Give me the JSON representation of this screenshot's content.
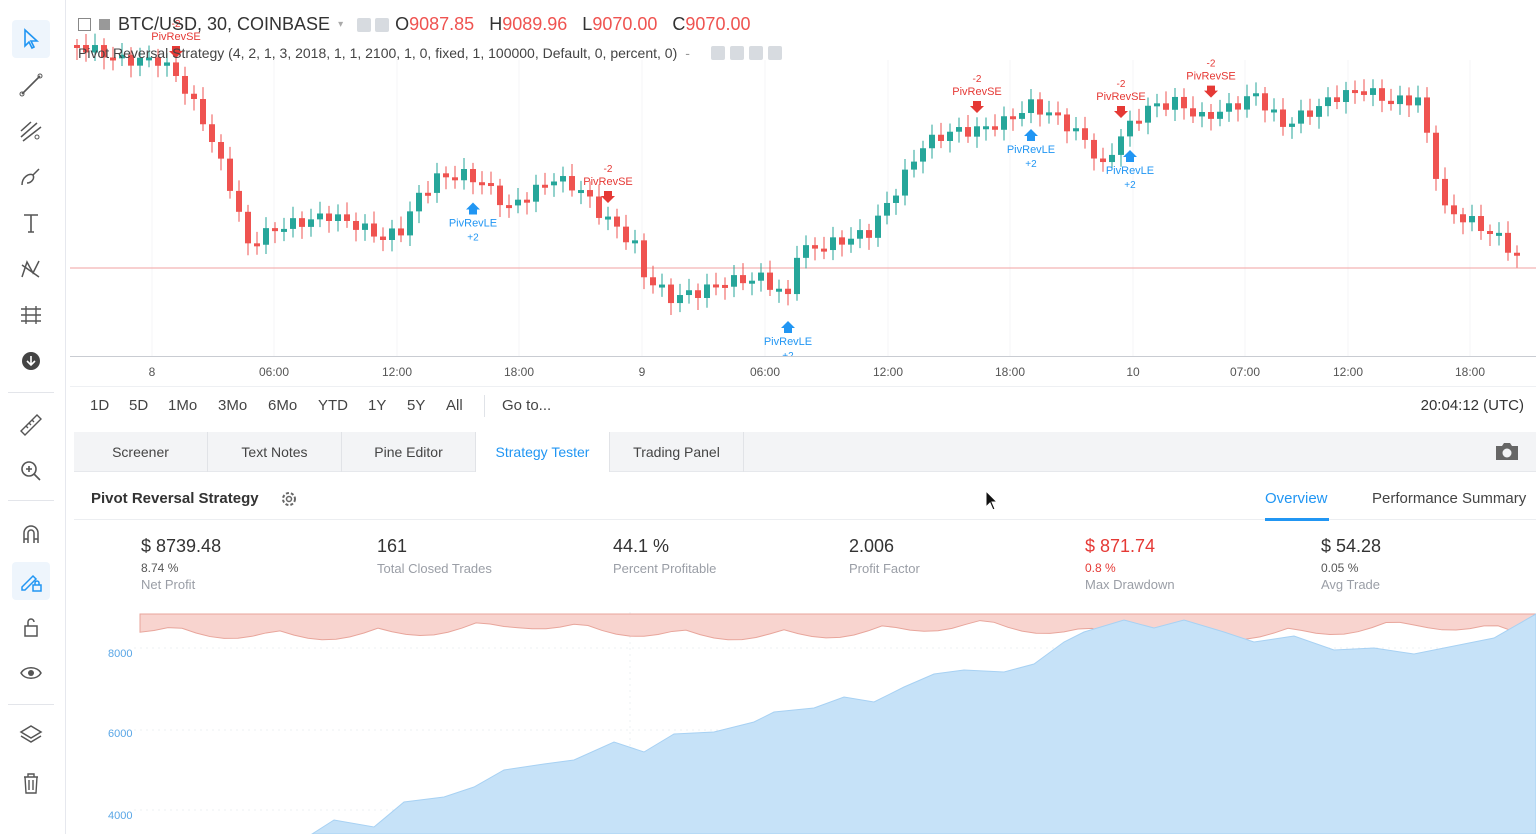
{
  "toolbar": {
    "tools": [
      "cursor-icon",
      "trend-line-icon",
      "fib-retracement-icon",
      "brush-icon",
      "text-icon",
      "pattern-icon",
      "prediction-icon",
      "remove-drawings-icon",
      "ruler-icon",
      "zoom-in-icon",
      "magnet-icon",
      "lock-drawing-icon",
      "unlock-icon",
      "eye-icon",
      "layers-icon",
      "trash-icon"
    ]
  },
  "chart": {
    "symbol": "BTC/USD, 30, COINBASE",
    "open_label": "O",
    "open": "9087.85",
    "high_label": "H",
    "high": "9089.96",
    "low_label": "L",
    "low": "9070.00",
    "close_label": "C",
    "close": "9070.00",
    "study": "Pivot Reversal Strategy (4, 2, 1, 3, 2018, 1, 1, 2100, 1, 0, fixed, 1, 100000, Default, 0, percent, 0)",
    "time_labels": [
      "8",
      "06:00",
      "12:00",
      "18:00",
      "9",
      "06:00",
      "12:00",
      "18:00",
      "10",
      "07:00",
      "12:00",
      "18:00"
    ],
    "ranges": [
      "1D",
      "5D",
      "1Mo",
      "3Mo",
      "6Mo",
      "YTD",
      "1Y",
      "5Y",
      "All"
    ],
    "goto": "Go to...",
    "clock": "20:04:12 (UTC)",
    "colors": {
      "up": "#26a69a",
      "down": "#ef5350",
      "long": "#2196f3",
      "short": "#e53935"
    },
    "signals": [
      {
        "type": "short",
        "label": "PivRevSE",
        "qty": "-2",
        "bar": 11
      },
      {
        "type": "long",
        "label": "PivRevLE",
        "qty": "+2",
        "bar": 44
      },
      {
        "type": "short",
        "label": "PivRevSE",
        "qty": "-2",
        "bar": 59
      },
      {
        "type": "long",
        "label": "PivRevLE",
        "qty": "+2",
        "bar": 79
      },
      {
        "type": "short",
        "label": "PivRevSE",
        "qty": "-2",
        "bar": 100
      },
      {
        "type": "long",
        "label": "PivRevLE",
        "qty": "+2",
        "bar": 106
      },
      {
        "type": "short",
        "label": "PivRevSE",
        "qty": "-2",
        "bar": 116
      },
      {
        "type": "long",
        "label": "PivRevLE",
        "qty": "+2",
        "bar": 117
      },
      {
        "type": "short",
        "label": "PivRevSE",
        "qty": "-2",
        "bar": 126
      }
    ]
  },
  "panel": {
    "tabs": [
      "Screener",
      "Text Notes",
      "Pine Editor",
      "Strategy Tester",
      "Trading Panel"
    ],
    "active_tab": "Strategy Tester",
    "strategy_name": "Pivot Reversal Strategy",
    "subtabs": [
      "Overview",
      "Performance Summary"
    ],
    "metrics": [
      {
        "value": "$ 8739.48",
        "pct": "8.74 %",
        "label": "Net Profit",
        "negative": false
      },
      {
        "value": "161",
        "pct": "",
        "label": "Total Closed Trades",
        "negative": false
      },
      {
        "value": "44.1 %",
        "pct": "",
        "label": "Percent Profitable",
        "negative": false
      },
      {
        "value": "2.006",
        "pct": "",
        "label": "Profit Factor",
        "negative": false
      },
      {
        "value": "$ 871.74",
        "pct": "0.8 %",
        "label": "Max Drawdown",
        "negative": true
      },
      {
        "value": "$ 54.28",
        "pct": "0.05 %",
        "label": "Avg Trade",
        "negative": false
      }
    ],
    "equity_axis": [
      "8000",
      "6000",
      "4000"
    ]
  }
}
